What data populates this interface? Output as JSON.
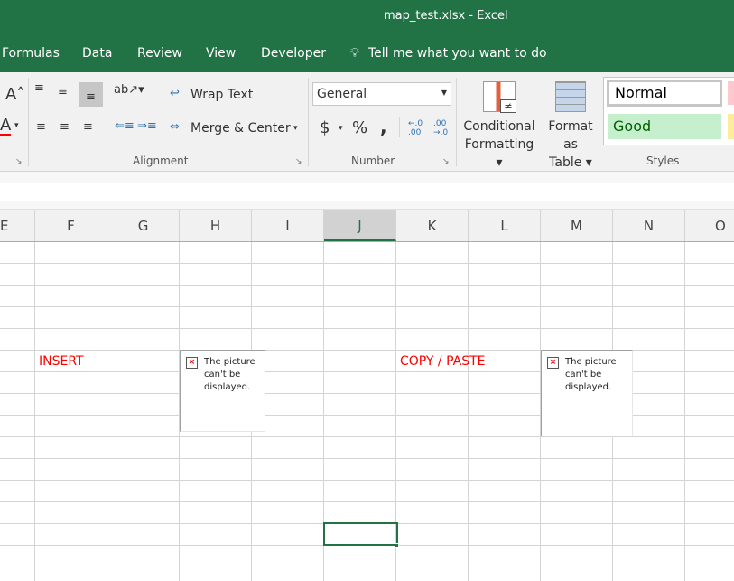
{
  "window": {
    "title": "map_test.xlsx  -  Excel"
  },
  "tabs": [
    "Formulas",
    "Data",
    "Review",
    "View",
    "Developer"
  ],
  "tell_me": "Tell me what you want to do",
  "ribbon": {
    "alignment": {
      "label": "Alignment",
      "wrap_text": "Wrap Text",
      "merge_center": "Merge & Center"
    },
    "number": {
      "label": "Number",
      "format": "General",
      "currency": "$",
      "percent": "%",
      "comma": ",",
      "inc_decimal": ".00",
      "dec_decimal": ".0"
    },
    "styles": {
      "label": "Styles",
      "conditional": [
        "Conditional",
        "Formatting"
      ],
      "format_table": [
        "Format as",
        "Table"
      ],
      "normal": "Normal",
      "good": "Good",
      "accent": "#217346"
    }
  },
  "columns": [
    "E",
    "F",
    "G",
    "H",
    "I",
    "J",
    "K",
    "L",
    "M",
    "N",
    "O"
  ],
  "selected_column": "J",
  "cells": {
    "insert": "INSERT",
    "copy_paste": "COPY / PASTE"
  },
  "picture_error": "The picture can't be displayed."
}
